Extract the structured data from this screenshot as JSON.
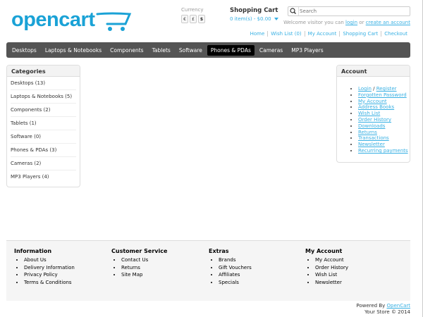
{
  "header": {
    "logo_text": "opencart",
    "currency": {
      "label": "Currency",
      "options": [
        "€",
        "£",
        "$"
      ]
    },
    "cart": {
      "title": "Shopping Cart",
      "summary": "0 item(s) - $0.00"
    },
    "search": {
      "placeholder": "Search"
    },
    "welcome": {
      "prefix": "Welcome visitor you can ",
      "login": "login",
      "or": " or ",
      "create": "create an account"
    },
    "links": [
      "Home",
      "Wish List (0)",
      "My Account",
      "Shopping Cart",
      "Checkout"
    ]
  },
  "menu": {
    "items": [
      "Desktops",
      "Laptops & Notebooks",
      "Components",
      "Tablets",
      "Software",
      "Phones & PDAs",
      "Cameras",
      "MP3 Players"
    ],
    "active": "Phones & PDAs"
  },
  "categories": {
    "title": "Categories",
    "items": [
      "Desktops (13)",
      "Laptops & Notebooks (5)",
      "Components (2)",
      "Tablets (1)",
      "Software (0)",
      "Phones & PDAs (3)",
      "Cameras (2)",
      "MP3 Players (4)"
    ]
  },
  "account": {
    "title": "Account",
    "login": "Login",
    "sep": " / ",
    "register": "Register",
    "items": [
      "Forgotten Password",
      "My Account",
      "Address Books",
      "Wish List",
      "Order History",
      "Downloads",
      "Returns",
      "Transactions",
      "Newsletter",
      "Recurring payments"
    ]
  },
  "footer": {
    "columns": [
      {
        "title": "Information",
        "items": [
          "About Us",
          "Delivery Information",
          "Privacy Policy",
          "Terms & Conditions"
        ]
      },
      {
        "title": "Customer Service",
        "items": [
          "Contact Us",
          "Returns",
          "Site Map"
        ]
      },
      {
        "title": "Extras",
        "items": [
          "Brands",
          "Gift Vouchers",
          "Affiliates",
          "Specials"
        ]
      },
      {
        "title": "My Account",
        "items": [
          "My Account",
          "Order History",
          "Wish List",
          "Newsletter"
        ]
      }
    ],
    "powered_prefix": "Powered By ",
    "powered_link": "OpenCart",
    "store": "Your Store © 2014"
  },
  "colors": {
    "accent": "#38b0e3",
    "logo": "#1aa2d6",
    "menu_bg": "#545454"
  }
}
